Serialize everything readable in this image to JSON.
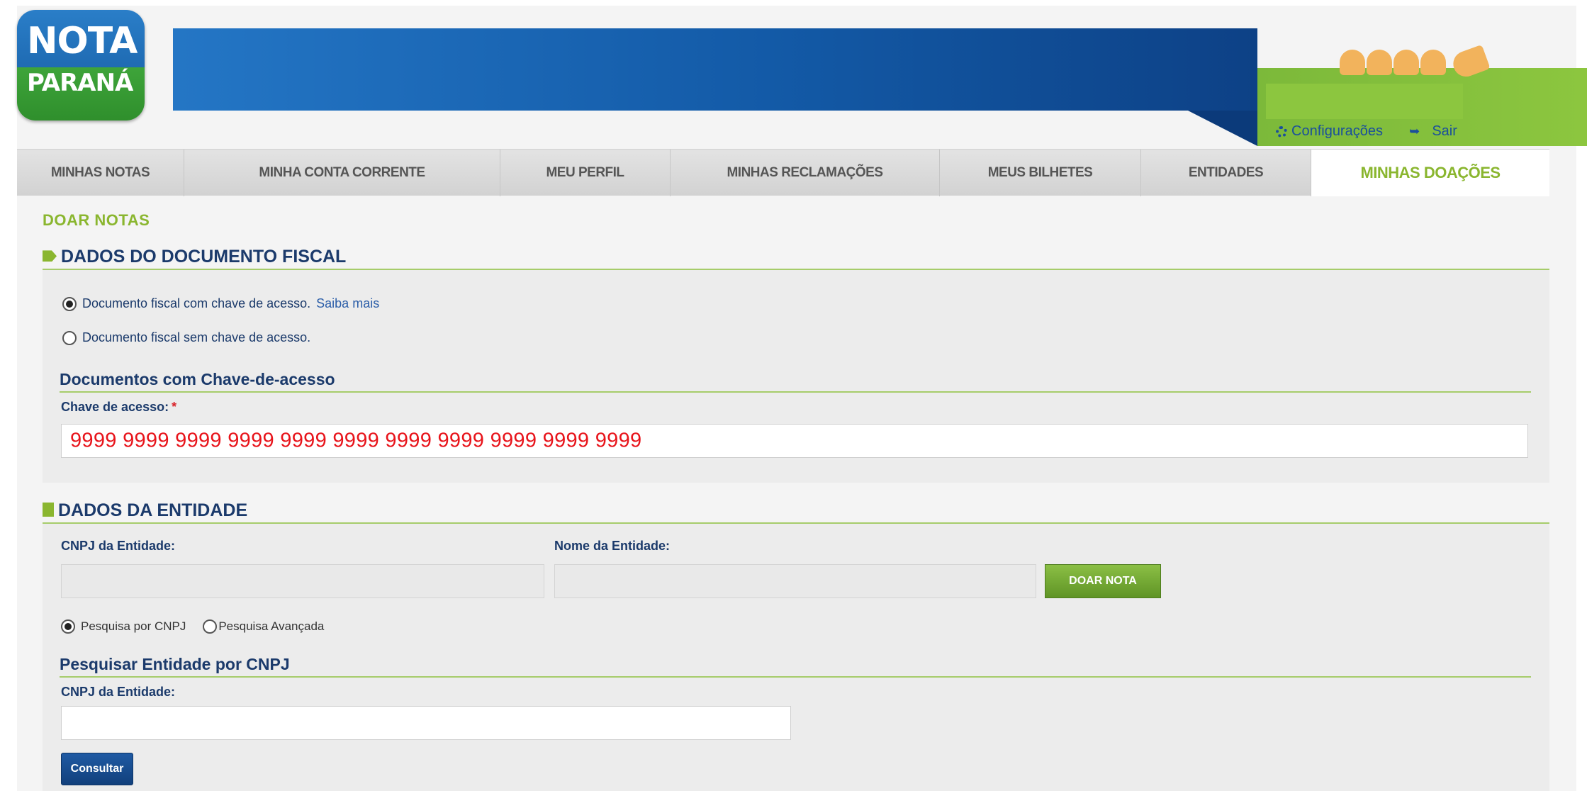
{
  "logo": {
    "line1": "NOTA",
    "line2": "PARANÁ"
  },
  "userlinks": {
    "config_label": "Configurações",
    "exit_label": "Sair"
  },
  "nav": {
    "tabs": [
      {
        "label": "MINHAS NOTAS"
      },
      {
        "label": "MINHA CONTA CORRENTE"
      },
      {
        "label": "MEU PERFIL"
      },
      {
        "label": "MINHAS RECLAMAÇÕES"
      },
      {
        "label": "MEUS BILHETES"
      },
      {
        "label": "ENTIDADES"
      },
      {
        "label": "MINHAS DOAÇÕES"
      }
    ],
    "active_tab": "MINHAS DOAÇÕES"
  },
  "page": {
    "title": "DOAR NOTAS"
  },
  "fiscal": {
    "heading": "DADOS DO DOCUMENTO FISCAL",
    "option_with_key": "Documento fiscal com chave de acesso.",
    "learn_more": "Saiba mais",
    "option_without_key": "Documento fiscal sem chave de acesso.",
    "selected_option": "Documento fiscal com chave de acesso.",
    "subheading": "Documentos com Chave-de-acesso",
    "key_label": "Chave de acesso:",
    "required_mark": "*",
    "key_value": "9999 9999 9999 9999 9999 9999 9999 9999 9999 9999 9999"
  },
  "entity": {
    "heading": "DADOS DA ENTIDADE",
    "cnpj_label": "CNPJ da Entidade:",
    "name_label": "Nome da Entidade:",
    "cnpj_value": "",
    "name_value": "",
    "donate_button": "DOAR NOTA",
    "search_by_cnpj": "Pesquisa por CNPJ",
    "advanced_search": "Pesquisa Avançada",
    "selected_search": "Pesquisa por CNPJ",
    "search_subheading": "Pesquisar Entidade por CNPJ",
    "search_cnpj_label": "CNPJ da Entidade:",
    "search_cnpj_value": "",
    "consult_button": "Consultar"
  },
  "colors": {
    "brand_green": "#8ab62f",
    "brand_blue": "#1b3a6b",
    "key_value_red": "#e8141b"
  }
}
